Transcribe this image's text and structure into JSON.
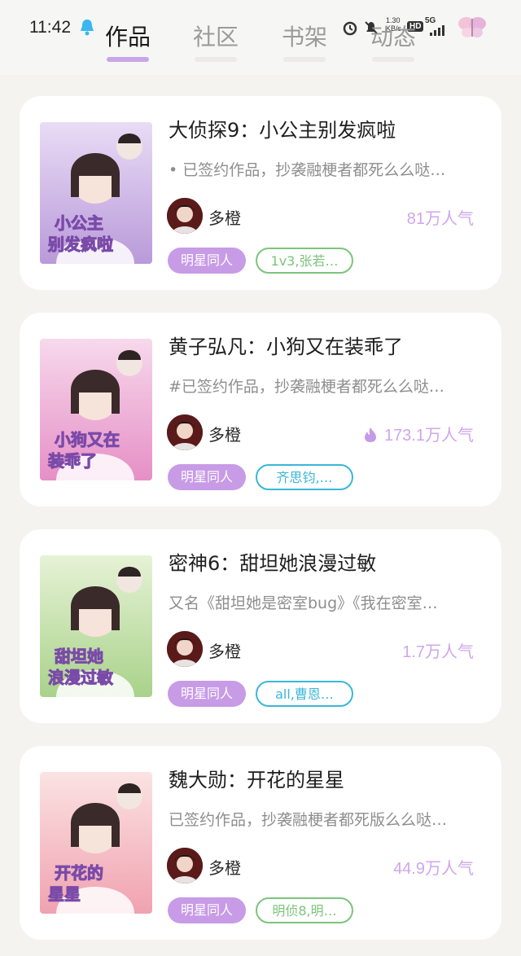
{
  "status_bar": {
    "time": "11:42",
    "net_speed": "1.30\nKB/s",
    "hd": "HD",
    "network": "5G"
  },
  "tabs": [
    {
      "label": "作品",
      "active": true
    },
    {
      "label": "社区",
      "active": false
    },
    {
      "label": "书架",
      "active": false
    },
    {
      "label": "动态",
      "active": false
    }
  ],
  "works": [
    {
      "title": "大侦探9：小公主别发疯啦",
      "description": "• 已签约作品，抄袭融梗者都死么么哒…",
      "author": "多橙",
      "popularity": "81万人气",
      "hot": false,
      "category_tag": "明星同人",
      "cp_tag": "1v3,张若…",
      "cp_color": "#7cc47c",
      "cover_text_1": "小公主",
      "cover_text_2": "别发疯啦",
      "cover_colors": [
        "#e9dcf6",
        "#b99ad9"
      ]
    },
    {
      "title": "黄子弘凡：小狗又在装乖了",
      "description": "#已签约作品，抄袭融梗者都死么么哒…",
      "author": "多橙",
      "popularity": "173.1万人气",
      "hot": true,
      "category_tag": "明星同人",
      "cp_tag": "齐思钧,…",
      "cp_color": "#3ab7d8",
      "cover_text_1": "小狗又在",
      "cover_text_2": "装乖了",
      "cover_colors": [
        "#f7d9ec",
        "#e68fc6"
      ]
    },
    {
      "title": "密神6：甜坦她浪漫过敏",
      "description": "又名《甜坦她是密室bug》《我在密室…",
      "author": "多橙",
      "popularity": "1.7万人气",
      "hot": false,
      "category_tag": "明星同人",
      "cp_tag": "all,曹恩…",
      "cp_color": "#3ab7d8",
      "cover_text_1": "甜坦她",
      "cover_text_2": "浪漫过敏",
      "cover_colors": [
        "#e6f2d6",
        "#a9d28a"
      ]
    },
    {
      "title": "魏大勋：开花的星星",
      "description": "已签约作品，抄袭融梗者都死版么么哒…",
      "author": "多橙",
      "popularity": "44.9万人气",
      "hot": false,
      "category_tag": "明星同人",
      "cp_tag": "明侦8,明…",
      "cp_color": "#7cc47c",
      "cover_text_1": "开花的",
      "cover_text_2": "星星",
      "cover_colors": [
        "#fbe3e3",
        "#f0a2b0"
      ]
    }
  ]
}
